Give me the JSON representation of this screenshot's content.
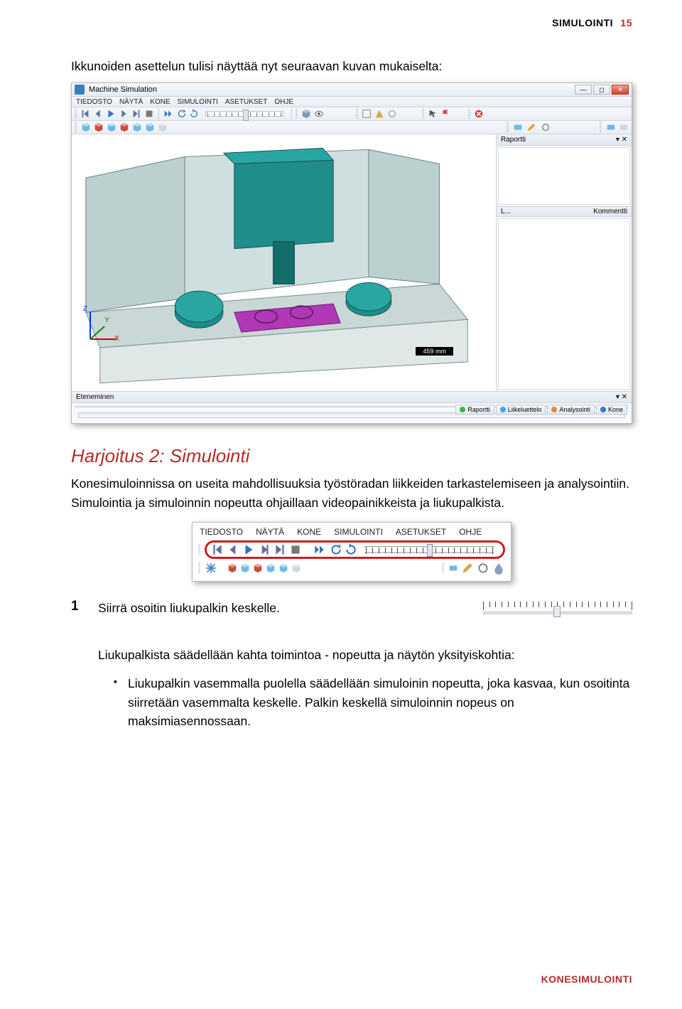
{
  "header": {
    "section": "SIMULOINTI",
    "page_num": "15"
  },
  "intro": "Ikkunoiden asettelun tulisi näyttää nyt seuraavan kuvan mukaiselta:",
  "app": {
    "title": "Machine Simulation",
    "report_panel": "Raportti",
    "report_cols": {
      "c1": "L...",
      "c2": "Kommentti"
    },
    "progress_panel": "Eteneminen",
    "tabs": {
      "raportti": "Raportti",
      "liike": "Liikeluettelo",
      "analyysi": "Analysointi",
      "kone": "Kone"
    },
    "scale_label": "459 mm",
    "axes": {
      "x": "X",
      "y": "Y",
      "z": "Z"
    },
    "menu": {
      "tiedosto": "TIEDOSTO",
      "nayta": "NÄYTÄ",
      "kone": "KONE",
      "simulointi": "SIMULOINTI",
      "asetukset": "ASETUKSET",
      "ohje": "OHJE"
    }
  },
  "exercise": {
    "title": "Harjoitus 2: Simulointi",
    "para": "Konesimuloinnissa on useita mahdollisuuksia työstöradan liikkeiden tarkastelemiseen ja analysointiin. Simulointia ja simuloinnin nopeutta ohjaillaan videopainikkeista ja liukupalkista."
  },
  "step1": {
    "num": "1",
    "text": "Siirrä osoitin liukupalkin keskelle."
  },
  "sub": {
    "lead": "Liukupalkista säädellään kahta toimintoa - nopeutta ja näytön yksityiskohtia:",
    "bullet1": "Liukupalkin vasemmalla puolella säädellään simuloinin nopeutta, joka kasvaa, kun osoitinta siirretään vasemmalta keskelle. Palkin keskellä simuloinnin nopeus on maksimiasennossaan."
  },
  "footer": "KONESIMULOINTI"
}
